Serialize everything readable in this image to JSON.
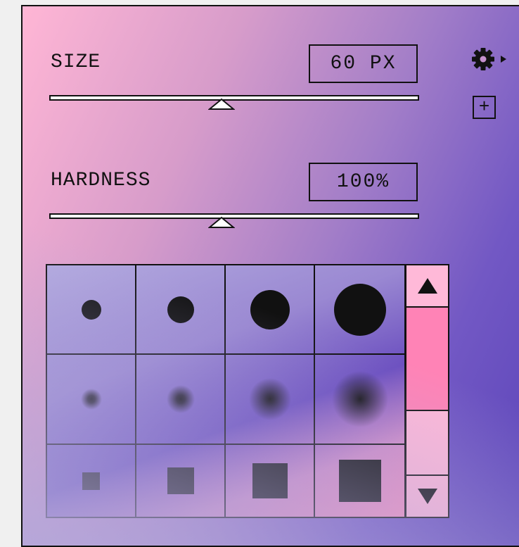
{
  "size": {
    "label": "SIZE",
    "value": "60 PX",
    "slider_fraction": 0.5
  },
  "hardness": {
    "label": "HARDNESS",
    "value": "100%",
    "slider_fraction": 0.5
  },
  "toolbar": {
    "settings_icon": "gear-icon",
    "settings_arrow_icon": "triangle-right-icon",
    "add_icon": "plus-box-icon",
    "add_glyph": "+"
  },
  "presets": {
    "rows": [
      {
        "type": "hard-round",
        "items": [
          "small",
          "medium",
          "large",
          "xlarge"
        ]
      },
      {
        "type": "soft-round",
        "items": [
          "small",
          "medium",
          "large",
          "xlarge"
        ]
      },
      {
        "type": "square",
        "items": [
          "small",
          "medium",
          "large",
          "xlarge"
        ]
      }
    ]
  },
  "scrollbar": {
    "up_icon": "triangle-up-icon",
    "down_icon": "triangle-down-icon"
  },
  "colors": {
    "accent_pink": "#ff83b6",
    "panel_purple": "#5b44b9",
    "ink": "#111111"
  }
}
